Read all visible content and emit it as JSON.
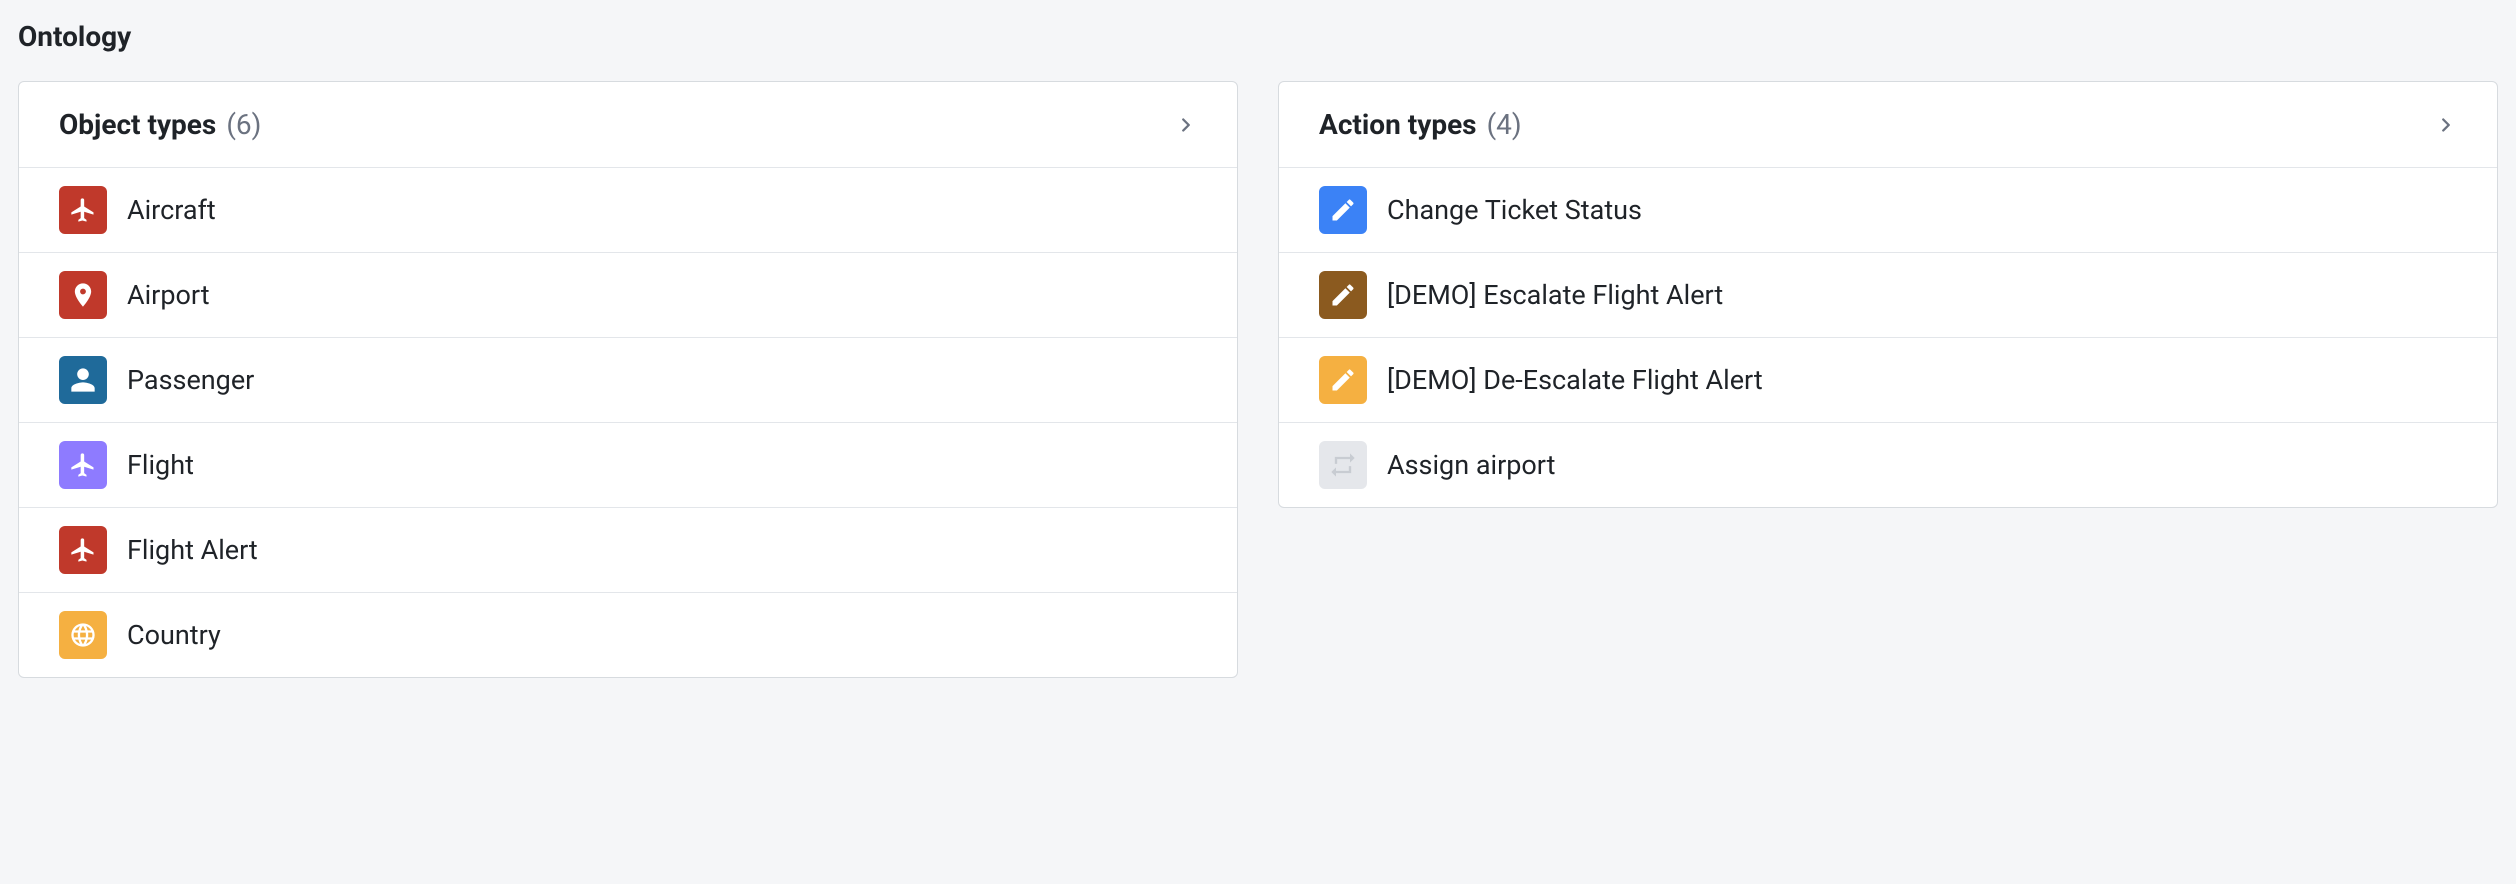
{
  "page_title": "Ontology",
  "object_types": {
    "title": "Object types",
    "count": "(6)",
    "items": [
      {
        "label": "Aircraft",
        "icon": "airplane",
        "color": "#c0392b"
      },
      {
        "label": "Airport",
        "icon": "pin",
        "color": "#c0392b"
      },
      {
        "label": "Passenger",
        "icon": "person",
        "color": "#1f6a9a"
      },
      {
        "label": "Flight",
        "icon": "airplane",
        "color": "#8e7bff"
      },
      {
        "label": "Flight Alert",
        "icon": "airplane",
        "color": "#c0392b"
      },
      {
        "label": "Country",
        "icon": "globe",
        "color": "#f5b041"
      }
    ]
  },
  "action_types": {
    "title": "Action types",
    "count": "(4)",
    "items": [
      {
        "label": "Change Ticket Status",
        "icon": "pencil",
        "color": "#3b82f6"
      },
      {
        "label": "[DEMO] Escalate Flight Alert",
        "icon": "pencil",
        "color": "#8b5a1f"
      },
      {
        "label": "[DEMO] De-Escalate Flight Alert",
        "icon": "pencil",
        "color": "#f5b041"
      },
      {
        "label": "Assign airport",
        "icon": "swap",
        "color": "#e5e7eb"
      }
    ]
  }
}
